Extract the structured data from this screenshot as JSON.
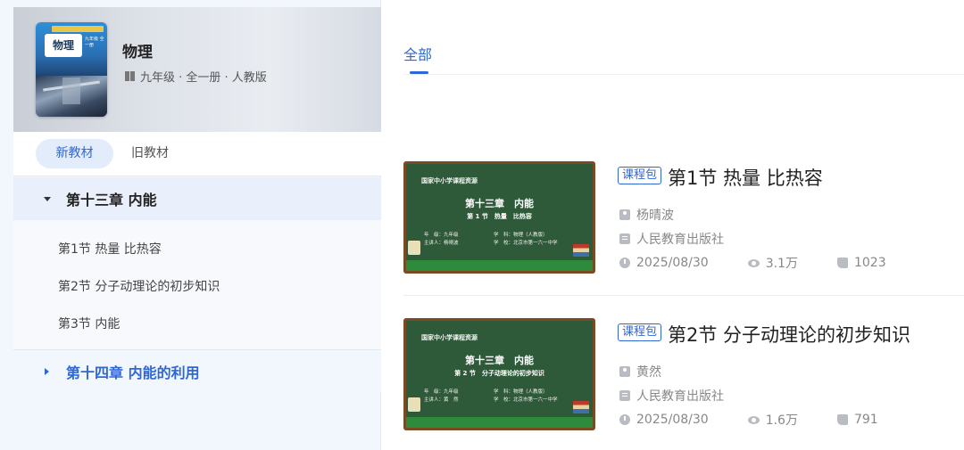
{
  "book": {
    "cover_title": "物理",
    "cover_grade": "九年级 全一册",
    "title": "物理",
    "meta": "九年级 · 全一册 · 人教版"
  },
  "tabs": {
    "new_label": "新教材",
    "old_label": "旧教材"
  },
  "chapters": [
    {
      "title": "第十三章 内能",
      "expanded": true,
      "sections": [
        "第1节 热量 比热容",
        "第2节 分子动理论的初步知识",
        "第3节 内能"
      ]
    },
    {
      "title": "第十四章 内能的利用",
      "expanded": false
    }
  ],
  "filter": {
    "all_label": "全部"
  },
  "cards": [
    {
      "tag": "课程包",
      "title": "第1节 热量 比热容",
      "author": "杨晴波",
      "publisher": "人民教育出版社",
      "date": "2025/08/30",
      "views": "3.1万",
      "likes": "1023",
      "thumb": {
        "source": "国家中小学课程资源",
        "chapter": "第十三章　内能",
        "section": "第 1 节　热量　比热容",
        "info_left": [
          "年　级：九年级",
          "主讲人：杨晴波"
        ],
        "info_right": [
          "学　科：物理（人教版）",
          "学　校：北京市第一六一中学"
        ]
      }
    },
    {
      "tag": "课程包",
      "title": "第2节 分子动理论的初步知识",
      "author": "黄然",
      "publisher": "人民教育出版社",
      "date": "2025/08/30",
      "views": "1.6万",
      "likes": "791",
      "thumb": {
        "source": "国家中小学课程资源",
        "chapter": "第十三章　内能",
        "section": "第 2 节　分子动理论的初步知识",
        "info_left": [
          "年　级：九年级",
          "主讲人：黄　然"
        ],
        "info_right": [
          "学　科：物理（人教版）",
          "学　校：北京市第一六一中学"
        ]
      }
    }
  ],
  "colors": {
    "accent": "#2f67d8",
    "chalkboard": "#2f5a3a",
    "sidebar_bg": "#f2f6fd"
  }
}
